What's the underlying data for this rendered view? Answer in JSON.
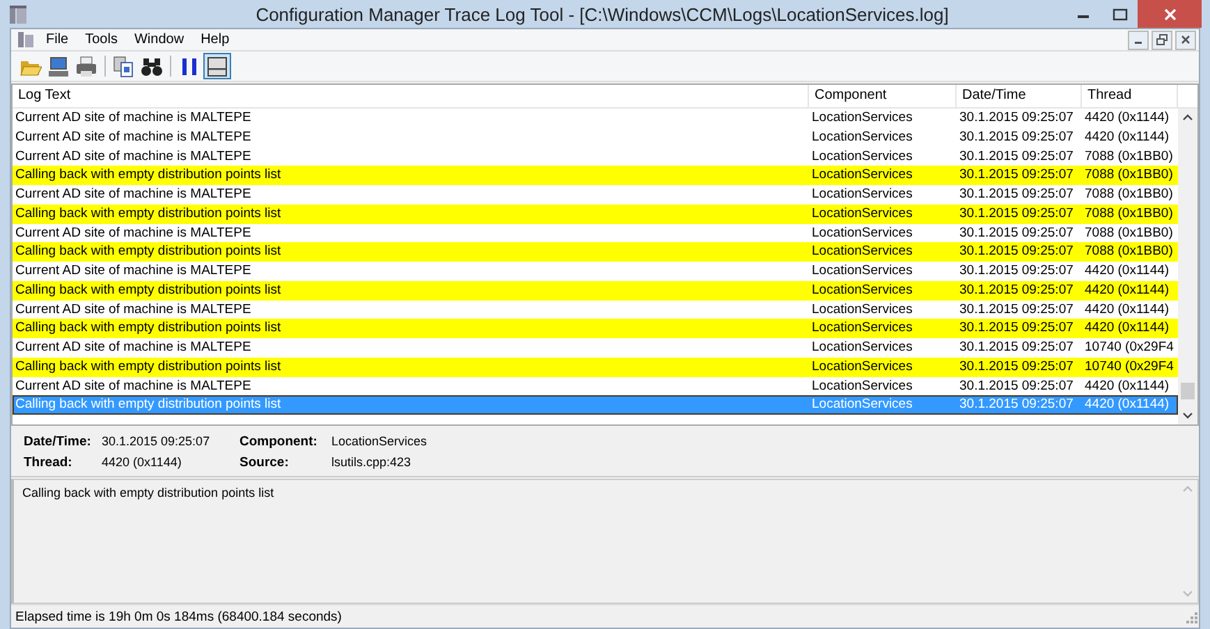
{
  "window": {
    "title": "Configuration Manager Trace Log Tool - [C:\\Windows\\CCM\\Logs\\LocationServices.log]"
  },
  "menu": [
    "File",
    "Tools",
    "Window",
    "Help"
  ],
  "toolbar": [
    {
      "kind": "open",
      "pressed": false
    },
    {
      "kind": "computer",
      "pressed": false
    },
    {
      "kind": "print",
      "pressed": false
    },
    {
      "kind": "separator"
    },
    {
      "kind": "copy",
      "pressed": false
    },
    {
      "kind": "find",
      "pressed": false
    },
    {
      "kind": "separator"
    },
    {
      "kind": "pause",
      "pressed": false
    },
    {
      "kind": "pane",
      "pressed": true
    }
  ],
  "log": {
    "columns": [
      "Log Text",
      "Component",
      "Date/Time",
      "Thread"
    ],
    "rows": [
      {
        "text": "Current AD site of machine is MALTEPE",
        "component": "LocationServices",
        "datetime": "30.1.2015 09:25:07",
        "thread": "4420 (0x1144)",
        "highlighted": false,
        "selected": false
      },
      {
        "text": "Current AD site of machine is MALTEPE",
        "component": "LocationServices",
        "datetime": "30.1.2015 09:25:07",
        "thread": "4420 (0x1144)",
        "highlighted": false,
        "selected": false
      },
      {
        "text": "Current AD site of machine is MALTEPE",
        "component": "LocationServices",
        "datetime": "30.1.2015 09:25:07",
        "thread": "7088 (0x1BB0)",
        "highlighted": false,
        "selected": false
      },
      {
        "text": "Calling back with empty distribution points list",
        "component": "LocationServices",
        "datetime": "30.1.2015 09:25:07",
        "thread": "7088 (0x1BB0)",
        "highlighted": true,
        "selected": false
      },
      {
        "text": "Current AD site of machine is MALTEPE",
        "component": "LocationServices",
        "datetime": "30.1.2015 09:25:07",
        "thread": "7088 (0x1BB0)",
        "highlighted": false,
        "selected": false
      },
      {
        "text": "Calling back with empty distribution points list",
        "component": "LocationServices",
        "datetime": "30.1.2015 09:25:07",
        "thread": "7088 (0x1BB0)",
        "highlighted": true,
        "selected": false
      },
      {
        "text": "Current AD site of machine is MALTEPE",
        "component": "LocationServices",
        "datetime": "30.1.2015 09:25:07",
        "thread": "7088 (0x1BB0)",
        "highlighted": false,
        "selected": false
      },
      {
        "text": "Calling back with empty distribution points list",
        "component": "LocationServices",
        "datetime": "30.1.2015 09:25:07",
        "thread": "7088 (0x1BB0)",
        "highlighted": true,
        "selected": false
      },
      {
        "text": "Current AD site of machine is MALTEPE",
        "component": "LocationServices",
        "datetime": "30.1.2015 09:25:07",
        "thread": "4420 (0x1144)",
        "highlighted": false,
        "selected": false
      },
      {
        "text": "Calling back with empty distribution points list",
        "component": "LocationServices",
        "datetime": "30.1.2015 09:25:07",
        "thread": "4420 (0x1144)",
        "highlighted": true,
        "selected": false
      },
      {
        "text": "Current AD site of machine is MALTEPE",
        "component": "LocationServices",
        "datetime": "30.1.2015 09:25:07",
        "thread": "4420 (0x1144)",
        "highlighted": false,
        "selected": false
      },
      {
        "text": "Calling back with empty distribution points list",
        "component": "LocationServices",
        "datetime": "30.1.2015 09:25:07",
        "thread": "4420 (0x1144)",
        "highlighted": true,
        "selected": false
      },
      {
        "text": "Current AD site of machine is MALTEPE",
        "component": "LocationServices",
        "datetime": "30.1.2015 09:25:07",
        "thread": "10740 (0x29F4",
        "highlighted": false,
        "selected": false
      },
      {
        "text": "Calling back with empty distribution points list",
        "component": "LocationServices",
        "datetime": "30.1.2015 09:25:07",
        "thread": "10740 (0x29F4",
        "highlighted": true,
        "selected": false
      },
      {
        "text": "Current AD site of machine is MALTEPE",
        "component": "LocationServices",
        "datetime": "30.1.2015 09:25:07",
        "thread": "4420 (0x1144)",
        "highlighted": false,
        "selected": false
      },
      {
        "text": "Calling back with empty distribution points list",
        "component": "LocationServices",
        "datetime": "30.1.2015 09:25:07",
        "thread": "4420 (0x1144)",
        "highlighted": false,
        "selected": true
      }
    ]
  },
  "details": {
    "fields": [
      {
        "label": "Date/Time:",
        "value": "30.1.2015 09:25:07"
      },
      {
        "label": "Component:",
        "value": "LocationServices"
      },
      {
        "label": "Thread:",
        "value": "4420 (0x1144)"
      },
      {
        "label": "Source:",
        "value": "lsutils.cpp:423"
      }
    ],
    "message": "Calling back with empty distribution points list"
  },
  "status_bar": "Elapsed time is 19h 0m 0s 184ms (68400.184 seconds)"
}
